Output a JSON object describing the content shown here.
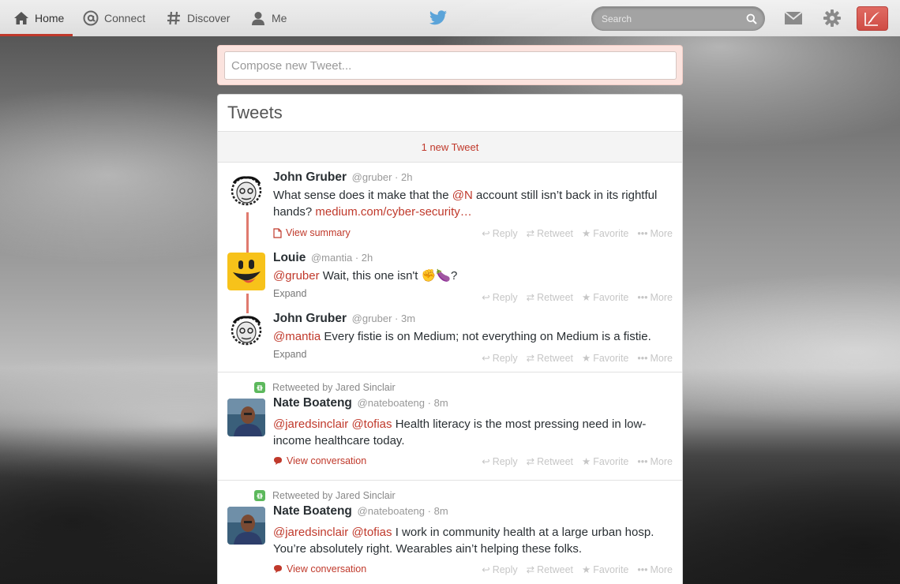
{
  "nav": {
    "home": "Home",
    "connect": "Connect",
    "discover": "Discover",
    "me": "Me",
    "search_placeholder": "Search"
  },
  "compose": {
    "placeholder": "Compose new Tweet..."
  },
  "timeline": {
    "title": "Tweets",
    "new_tweets": "1 new Tweet",
    "actions": {
      "reply": "Reply",
      "retweet": "Retweet",
      "favorite": "Favorite",
      "more": "More"
    },
    "tweets": [
      {
        "name": "John Gruber",
        "handle": "@gruber",
        "time": "· 2h",
        "text_before": "What sense does it make that the ",
        "mention": "@N",
        "text_after": " account still isn’t back in its rightful hands? ",
        "link": "medium.com/cyber-security…",
        "sub": "View summary"
      },
      {
        "name": "Louie",
        "handle": "@mantia",
        "time": "· 2h",
        "mention": "@gruber",
        "text_after": " Wait, this one isn't ✊🍆?",
        "sub": "Expand"
      },
      {
        "name": "John Gruber",
        "handle": "@gruber",
        "time": "· 3m",
        "mention": "@mantia",
        "text_after": " Every fistie is on Medium; not everything on Medium is a fistie.",
        "sub": "Expand"
      },
      {
        "retweeted_by": "Retweeted by Jared Sinclair",
        "name": "Nate Boateng",
        "handle": "@nateboateng",
        "time": "· 8m",
        "mention": "@jaredsinclair",
        "mention2": "@tofias",
        "text_after": " Health literacy is the most pressing need in low-income healthcare today.",
        "sub": "View conversation"
      },
      {
        "retweeted_by": "Retweeted by Jared Sinclair",
        "name": "Nate Boateng",
        "handle": "@nateboateng",
        "time": "· 8m",
        "mention": "@jaredsinclair",
        "mention2": "@tofias",
        "text_after": " I work in community health at a large urban hosp. You’re absolutely right. Wearables ain’t helping these folks.",
        "sub": "View conversation"
      }
    ]
  },
  "colors": {
    "accent": "#c0392b",
    "thread_line": "#e07a6e",
    "retweet_green": "#5cb85c"
  }
}
